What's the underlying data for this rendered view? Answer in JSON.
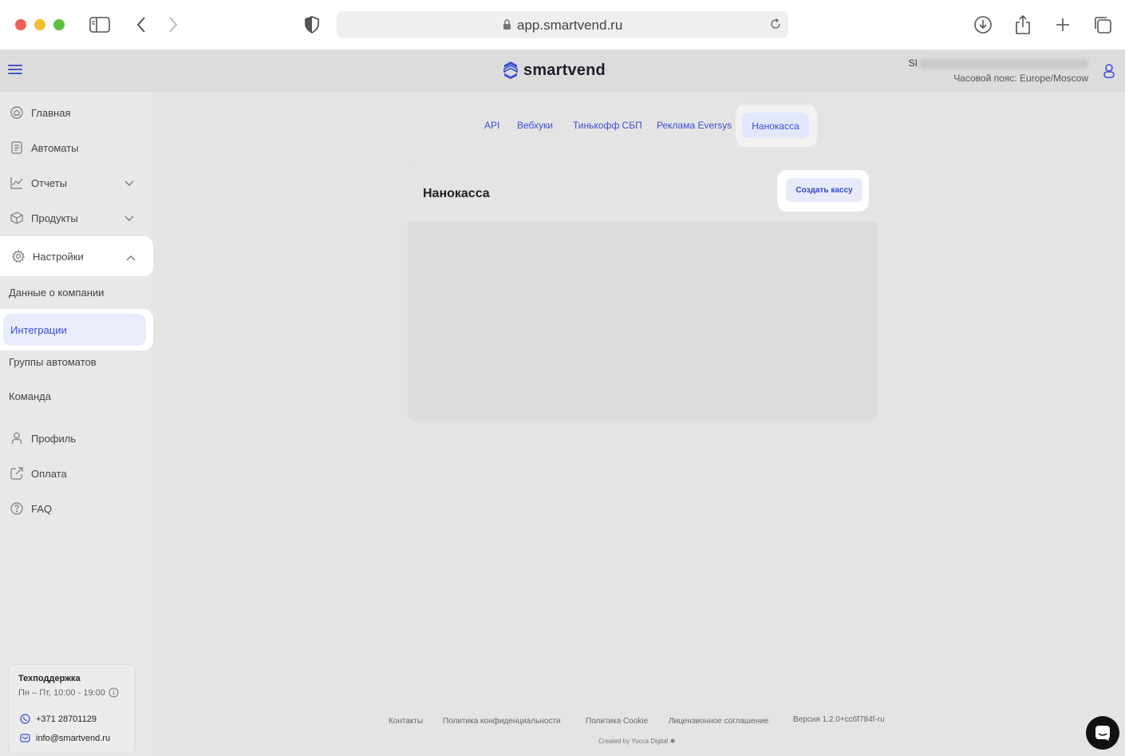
{
  "browser": {
    "url": "app.smartvend.ru",
    "lock_icon": "lock-icon",
    "reload_icon": "reload-icon"
  },
  "header": {
    "logo_text": "smartvend",
    "user_prefix": "SI",
    "timezone": "Часовой пояс: Europe/Moscow"
  },
  "sidebar": {
    "items": [
      {
        "label": "Главная",
        "icon": "home-icon"
      },
      {
        "label": "Автоматы",
        "icon": "document-icon"
      },
      {
        "label": "Отчеты",
        "icon": "chart-icon"
      },
      {
        "label": "Продукты",
        "icon": "box-icon"
      },
      {
        "label": "Настройки",
        "icon": "gear-icon"
      },
      {
        "label": "Профиль",
        "icon": "user-icon"
      },
      {
        "label": "Оплата",
        "icon": "external-link-icon"
      },
      {
        "label": "FAQ",
        "icon": "question-icon"
      }
    ],
    "settings_sub": [
      "Данные о компании",
      "Интеграции",
      "Группы автоматов",
      "Команда"
    ],
    "support": {
      "title": "Техподдержка",
      "hours": "Пн – Пт, 10:00 - 19:00",
      "phone": "+371 28701129",
      "email": "info@smartvend.ru"
    }
  },
  "tabs": [
    "API",
    "Вебхуки",
    "Тинькофф СБП",
    "Реклама Eversys",
    "Нанокасса"
  ],
  "card": {
    "title": "Нанокасса",
    "create_button": "Создать кассу"
  },
  "footer": {
    "links": [
      "Контакты",
      "Политика конфиденциальности",
      "Политика Cookie",
      "Лицензионное соглашение"
    ],
    "version": "Версия 1.2.0+cc6f784f-ru",
    "credit": "Created by Yucca Digital"
  },
  "colors": {
    "accent": "#3b4fd4",
    "sidebar_bg": "#e8e8e8",
    "content_bg": "#e4e4e4"
  }
}
